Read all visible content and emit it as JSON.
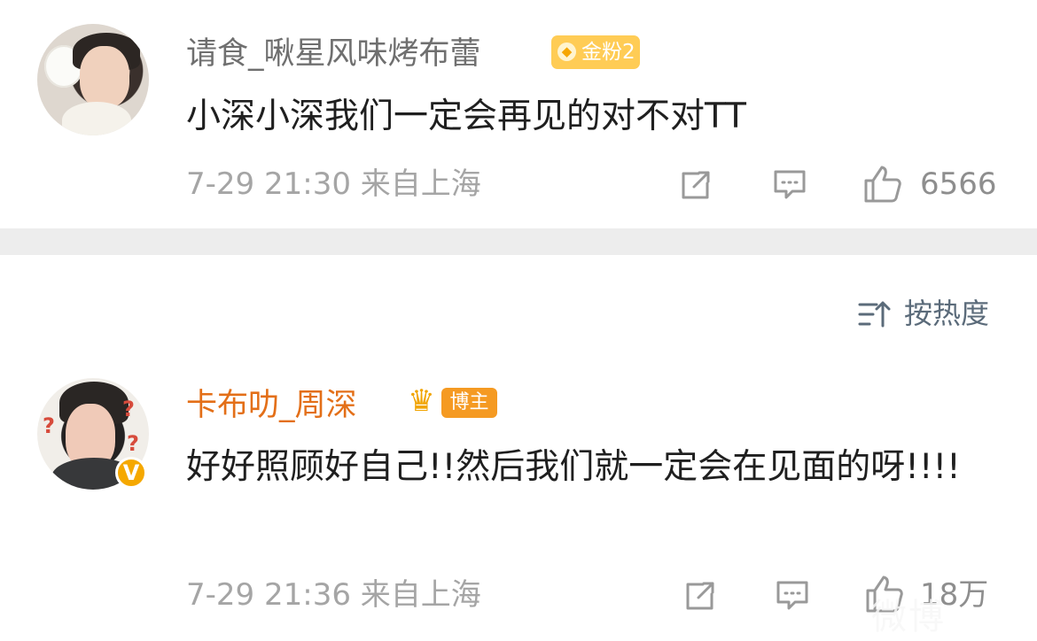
{
  "comments": [
    {
      "username": "请食_啾星风味烤布蕾",
      "badge": "金粉2",
      "text": "小深小深我们一定会再见的对不对TT",
      "time_location": "7-29 21:30 来自上海",
      "likes": "6566"
    },
    {
      "username": "卡布叻_周深",
      "badge": "博主",
      "text": "好好照顾好自己!!然后我们就一定会在见面的呀!!!!",
      "time_location": "7-29 21:36 来自上海",
      "likes": "18万"
    }
  ],
  "sort": {
    "label": "按热度"
  },
  "icons": {
    "share": "share-icon",
    "comment": "comment-icon",
    "like": "thumb-up-icon",
    "sort": "sort-icon",
    "verified": "verified-v-icon",
    "crown": "crown-icon",
    "fan_badge": "diamond-badge-icon"
  },
  "colors": {
    "username_primary": "#6f6f6f",
    "username_author": "#e36f18",
    "meta": "#a5a5a5",
    "separator": "#ededed",
    "badge_gold": "#ffcc55",
    "badge_orange": "#f59a22"
  },
  "watermark": {
    "text": "微博"
  }
}
